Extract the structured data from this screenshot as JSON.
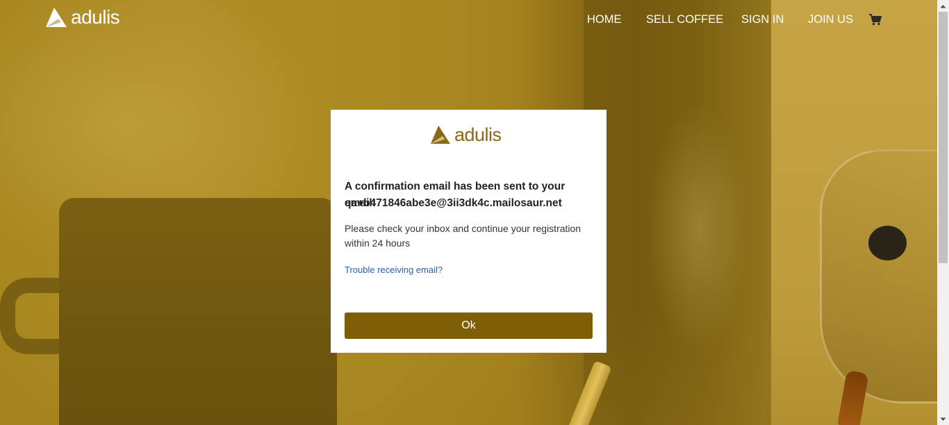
{
  "brand": {
    "name": "adulis",
    "header_logo_color": "#ffffff",
    "modal_logo_color": "#8b6912"
  },
  "nav": {
    "items": [
      {
        "label": "HOME"
      },
      {
        "label": "SELL COFFEE"
      },
      {
        "label": "SIGN IN"
      },
      {
        "label": "JOIN US"
      }
    ],
    "cart_icon": "shopping-cart-icon"
  },
  "modal": {
    "heading": "A confirmation email has been sent to your email:",
    "email": "qa+b471846abe3e@3ii3dk4c.mailosaur.net",
    "body": "Please check your inbox and continue your registration within 24 hours",
    "link_label": "Trouble receiving email?",
    "button_label": "Ok"
  },
  "colors": {
    "overlay_tint": "#a7851f",
    "button_bg": "#7f5f05",
    "link": "#2a5ea8"
  }
}
